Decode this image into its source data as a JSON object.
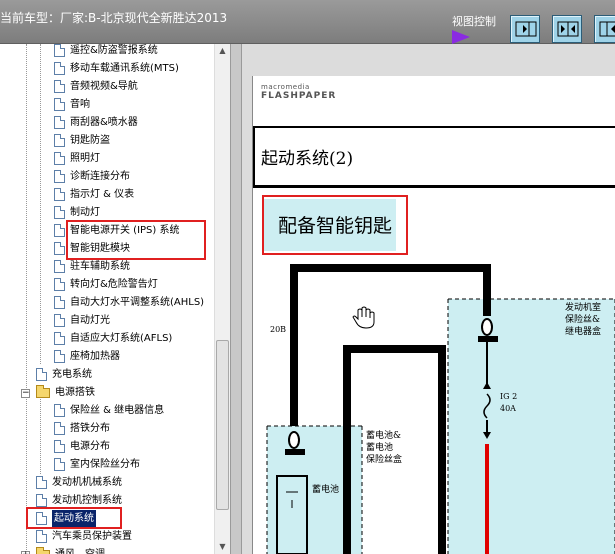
{
  "header": {
    "title": "当前车型：厂家:B-北京现代全新胜达2013",
    "view_control_label": "视图控制"
  },
  "tree": {
    "items": [
      {
        "label": "遥控&防盗警报系统",
        "type": "doc",
        "level": 2
      },
      {
        "label": "移动车载通讯系统(MTS)",
        "type": "doc",
        "level": 2
      },
      {
        "label": "音频视频&导航",
        "type": "doc",
        "level": 2
      },
      {
        "label": "音响",
        "type": "doc",
        "level": 2
      },
      {
        "label": "雨刮器&喷水器",
        "type": "doc",
        "level": 2
      },
      {
        "label": "钥匙防盗",
        "type": "doc",
        "level": 2
      },
      {
        "label": "照明灯",
        "type": "doc",
        "level": 2
      },
      {
        "label": "诊断连接分布",
        "type": "doc",
        "level": 2
      },
      {
        "label": "指示灯 & 仪表",
        "type": "doc",
        "level": 2
      },
      {
        "label": "制动灯",
        "type": "doc",
        "level": 2
      },
      {
        "label": "智能电源开关 (IPS) 系统",
        "type": "doc",
        "level": 2
      },
      {
        "label": "智能钥匙模块",
        "type": "doc",
        "level": 2
      },
      {
        "label": "驻车辅助系统",
        "type": "doc",
        "level": 2
      },
      {
        "label": "转向灯&危险警告灯",
        "type": "doc",
        "level": 2
      },
      {
        "label": "自动大灯水平调整系统(AHLS)",
        "type": "doc",
        "level": 2
      },
      {
        "label": "自动灯光",
        "type": "doc",
        "level": 2
      },
      {
        "label": "自适应大灯系统(AFLS)",
        "type": "doc",
        "level": 2
      },
      {
        "label": "座椅加热器",
        "type": "doc",
        "level": 2
      },
      {
        "label": "充电系统",
        "type": "doc",
        "level": 1
      },
      {
        "label": "电源搭铁",
        "type": "folder",
        "level": 1,
        "expander": "−"
      },
      {
        "label": "保险丝 & 继电器信息",
        "type": "doc",
        "level": 2
      },
      {
        "label": "搭铁分布",
        "type": "doc",
        "level": 2
      },
      {
        "label": "电源分布",
        "type": "doc",
        "level": 2
      },
      {
        "label": "室内保险丝分布",
        "type": "doc",
        "level": 2
      },
      {
        "label": "发动机机械系统",
        "type": "doc",
        "level": 1
      },
      {
        "label": "发动机控制系统",
        "type": "doc",
        "level": 1
      },
      {
        "label": "起动系统",
        "type": "doc",
        "level": 1,
        "selected": true
      },
      {
        "label": "汽车乘员保护装置",
        "type": "doc",
        "level": 1
      },
      {
        "label": "通风、空调",
        "type": "folder",
        "level": 1,
        "expander": "+"
      }
    ]
  },
  "viewer": {
    "logo_small": "macromedia",
    "logo_big": "FLASHPAPER",
    "doc_title": "起动系统(2)",
    "key_label": "配备智能钥匙",
    "diagram": {
      "wire_20b": "20B",
      "engine_room_box": [
        "发动机室",
        "保险丝&",
        "继电器盒"
      ],
      "fuse_label": [
        "IG 2",
        "40A"
      ],
      "battery_box": [
        "蓄电池&",
        "蓄电池",
        "保险丝盒"
      ],
      "battery": "蓄电池"
    }
  },
  "colors": {
    "header_bg": "#8a8a8a",
    "selection": "#0a246a",
    "annotation": "#e02020",
    "diagram_fill": "#cdeef2",
    "wire_red": "#e00000"
  }
}
